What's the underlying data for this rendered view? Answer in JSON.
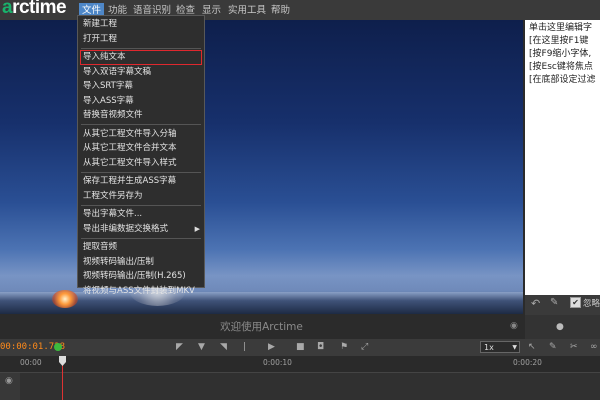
{
  "app": {
    "logo_prefix": "a",
    "logo_rest": "rctime"
  },
  "menubar": {
    "items": [
      {
        "label": "文件",
        "active": true
      },
      {
        "label": "功能"
      },
      {
        "label": "语音识别"
      },
      {
        "label": "检查"
      },
      {
        "label": "显示"
      },
      {
        "label": "实用工具"
      },
      {
        "label": "帮助"
      }
    ]
  },
  "file_menu": {
    "items": [
      "新建工程",
      "打开工程",
      "导入纯文本",
      "导入双语字幕文稿",
      "导入SRT字幕",
      "导入ASS字幕",
      "替换音视频文件",
      "从其它工程文件导入分轴",
      "从其它工程文件合并文本",
      "从其它工程文件导入样式",
      "保存工程并生成ASS字幕",
      "工程文件另存为",
      "导出字幕文件...",
      "导出非编数据交换格式",
      "提取音频",
      "视频转码输出/压制",
      "视频转码输出/压制(H.265)",
      "将视频与ASS文件封装到MKV"
    ],
    "highlighted": "导入纯文本"
  },
  "right_panel": {
    "lines": [
      "单击这里编辑字",
      "[在这里按F1键",
      "[按F9缩小字体,",
      "[按Esc键将焦点",
      "[在底部设定过滤"
    ],
    "checkbox_label": "忽略"
  },
  "subtitle_preview": "欢迎使用Arctime",
  "transport": {
    "timecode": "00:00:01.728",
    "speed": "1x"
  },
  "ruler": {
    "labels": [
      "00:00",
      "0:00:10",
      "0:00:20"
    ]
  },
  "colors": {
    "accent_green": "#19b26b",
    "menu_active": "#4e87c8",
    "highlight_box": "#e0282e",
    "timecode": "#ff8a1a"
  }
}
